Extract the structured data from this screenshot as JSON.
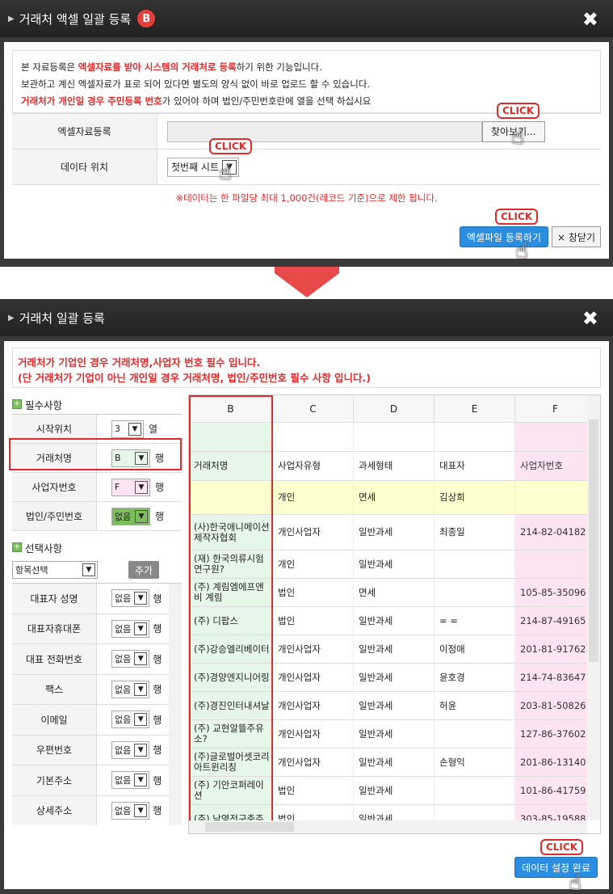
{
  "modal1": {
    "title": "거래처 액셀 일괄 등록",
    "badge": "B",
    "close": "✖",
    "info_lines": [
      {
        "pre": "본 자료등록은 ",
        "red": "엑셀자료를 받아 시스템의 거래처로 등록",
        "post": "하기 위한 기능입니다."
      },
      {
        "pre": "보관하고 계신 엑셀자료가 표로 되어 있다면 별도의 양식 없이 바로 업로드 할 수 있습니다.",
        "red": "",
        "post": ""
      },
      {
        "pre": "",
        "red": "거래처가 개인일 경우 주민등록 번호",
        "post": "가 있어야 하며 법인/주민번호란에 열을 선택 하십시요"
      }
    ],
    "excel_label": "엑셀자료등록",
    "browse_label": "찾아보기...",
    "data_pos_label": "데이타 위치",
    "data_pos_value": "첫번째 시트",
    "notice": "※데이터는 한 파일당 최대 1,000건(레코드 기준)으로 제한 됩니다.",
    "register_button": "엑셀파일 등록하기",
    "close_button": "× 창닫기",
    "click_label": "CLICK"
  },
  "modal2": {
    "title": "거래처 일괄 등록",
    "close": "✖",
    "notice_line1": "거래처가 기업인 경우 거래처명,사업자 번호 필수 입니다.",
    "notice_line2": "(단 거래처가 기업이 아닌 개인일 경우 거래처명, 법인/주민번호 필수 사항 입니다.)",
    "required_title": "필수사항",
    "required": [
      {
        "label": "시작위치",
        "value": "3",
        "unit": "열"
      },
      {
        "label": "거래처명",
        "value": "B",
        "unit": "행"
      },
      {
        "label": "사업자번호",
        "value": "F",
        "unit": "행"
      },
      {
        "label": "법인/주민번호",
        "value": "없음",
        "unit": "행"
      }
    ],
    "optional_title": "선택사항",
    "item_select": "항목선택",
    "add_button": "추가",
    "optional": [
      {
        "label": "대표자 성명",
        "value": "없음",
        "unit": "행"
      },
      {
        "label": "대표자휴대폰",
        "value": "없음",
        "unit": "행"
      },
      {
        "label": "대표 전화번호",
        "value": "없음",
        "unit": "행"
      },
      {
        "label": "팩스",
        "value": "없음",
        "unit": "행"
      },
      {
        "label": "이메일",
        "value": "없음",
        "unit": "행"
      },
      {
        "label": "우편번호",
        "value": "없음",
        "unit": "행"
      },
      {
        "label": "기본주소",
        "value": "없음",
        "unit": "행"
      },
      {
        "label": "상세주소",
        "value": "없음",
        "unit": "행"
      }
    ],
    "grid": {
      "headers": [
        "B",
        "C",
        "D",
        "E",
        "F"
      ],
      "rows": [
        [
          "",
          "",
          "",
          "",
          ""
        ],
        [
          "거래처명",
          "사업자유형",
          "과세형태",
          "대표자",
          "사업자번호"
        ],
        [
          "",
          "개인",
          "면세",
          "김상희",
          ""
        ],
        [
          "(사)한국애니메이션제작자협회",
          "개인사업자",
          "일반과세",
          "최종일",
          "214-82-04182"
        ],
        [
          "(재) 한국의류시험연구원?",
          "개인",
          "일반과세",
          "",
          ""
        ],
        [
          "(주) 계림엠에프앤비 계림",
          "법인",
          "면세",
          "",
          "105-85-35096"
        ],
        [
          "(주) 디팝스",
          "법인",
          "일반과세",
          "= =",
          "214-87-49165"
        ],
        [
          "(주)강승엘리베이터",
          "개인사업자",
          "일반과세",
          "이정애",
          "201-81-91762"
        ],
        [
          "(주)경양엔지니어링",
          "개인사업자",
          "일반과세",
          "윤호경",
          "214-74-83647"
        ],
        [
          "(주)경진인터내셔날",
          "개인사업자",
          "일반과세",
          "허윤",
          "203-81-50826"
        ],
        [
          "(주) 교현알뜰주유소?",
          "개인사업자",
          "일반과세",
          "",
          "127-86-37602"
        ],
        [
          "(주)글로벌어셋코리아트윈리칭",
          "개인사업자",
          "일반과세",
          "손형익",
          "201-86-13140"
        ],
        [
          "(주) 기안코퍼레이션",
          "법인",
          "일반과세",
          "",
          "101-86-41759"
        ],
        [
          "(주) 남영전구충주",
          "법인",
          "일반과세",
          "",
          "303-85-19588"
        ]
      ]
    },
    "done_button": "데이터 설정 완료",
    "click_label": "CLICK"
  },
  "colors": {
    "accent_red": "#e12b2b",
    "button_blue": "#2a8de0",
    "pink_col": "#fde4f3",
    "green_col": "#e6f7ea",
    "yellow_row": "#ffffd0"
  }
}
